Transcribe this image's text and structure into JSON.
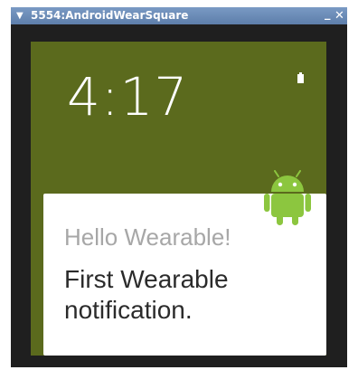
{
  "window": {
    "title": "5554:AndroidWearSquare",
    "menu_icon": "▼",
    "minimize_icon": "_",
    "close_icon": "✕"
  },
  "watch": {
    "time": "4:17",
    "background_color": "#5b6a1d",
    "battery_icon": "battery-icon"
  },
  "notification": {
    "title": "Hello Wearable!",
    "text": "First Wearable notification.",
    "app_icon": "android-robot-icon",
    "icon_color": "#8cc63f"
  }
}
